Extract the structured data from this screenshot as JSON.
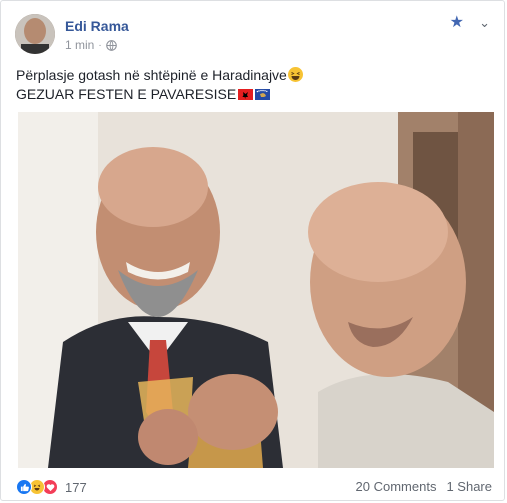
{
  "post": {
    "author": "Edi Rama",
    "time": "1 min",
    "line1": "Përplasje gotash në shtëpinë e Haradinajve",
    "line2": "GEZUAR FESTEN E PAVARESISE"
  },
  "reactions": {
    "count": "177"
  },
  "stats": {
    "comments": "20 Comments",
    "shares": "1 Share"
  }
}
